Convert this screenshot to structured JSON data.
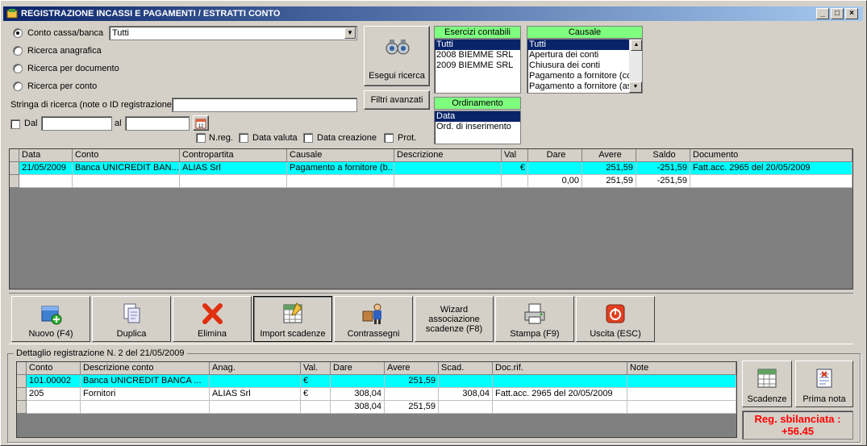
{
  "window": {
    "title": "REGISTRAZIONE INCASSI E PAGAMENTI / ESTRATTI CONTO"
  },
  "search": {
    "options": [
      {
        "label": "Conto cassa/banca",
        "selected": true
      },
      {
        "label": "Ricerca anagrafica",
        "selected": false
      },
      {
        "label": "Ricerca per documento",
        "selected": false
      },
      {
        "label": "Ricerca per conto",
        "selected": false
      }
    ],
    "account_value": "Tutti",
    "string_label": "Stringa di ricerca (note o ID registrazione)",
    "string_value": "",
    "dal_label": "Dal",
    "al_label": "al",
    "date_icon_text": "12",
    "flags": [
      "N.reg.",
      "Data valuta",
      "Data creazione",
      "Prot."
    ],
    "run_button": "Esegui ricerca",
    "advanced_button": "Filtri avanzati"
  },
  "esercizi": {
    "header": "Esercizi contabili",
    "items": [
      "Tutti",
      "2008 BIEMME SRL",
      "2009 BIEMME SRL"
    ]
  },
  "causale": {
    "header": "Causale",
    "items": [
      "Tutti",
      "Apertura dei conti",
      "Chiusura dei conti",
      "Pagamento a fornitore (co",
      "Pagamento a fornitore (as"
    ]
  },
  "ordinamento": {
    "header": "Ordinamento",
    "items": [
      "Data",
      "Ord. di inserimento"
    ]
  },
  "main_grid": {
    "columns": [
      "Data",
      "Conto",
      "Contropartita",
      "Causale",
      "Descrizione",
      "Val",
      "Dare",
      "Avere",
      "Saldo",
      "Documento"
    ],
    "rows": [
      [
        "21/05/2009",
        "Banca UNICREDIT BAN...",
        "ALIAS Srl",
        "Pagamento a fornitore (b...",
        "",
        "€",
        "",
        "251,59",
        "-251,59",
        "Fatt.acc. 2965 del 20/05/2009"
      ],
      [
        "",
        "",
        "",
        "",
        "",
        "",
        "0,00",
        "251,59",
        "-251,59",
        ""
      ]
    ]
  },
  "toolbar": {
    "nuovo": "Nuovo (F4)",
    "duplica": "Duplica",
    "elimina": "Elimina",
    "import": "Import scadenze",
    "contrassegni": "Contrassegni",
    "wizard": "Wizard associazione scadenze (F8)",
    "stampa": "Stampa (F9)",
    "uscita": "Uscita (ESC)"
  },
  "detail": {
    "legend": "Dettaglio registrazione N. 2 del 21/05/2009",
    "columns": [
      "Conto",
      "Descrizione conto",
      "Anag.",
      "Val.",
      "Dare",
      "Avere",
      "Scad.",
      "Doc.rif.",
      "Note"
    ],
    "rows": [
      [
        "101.00002",
        "Banca UNICREDIT BANCA ...",
        "",
        "€",
        "",
        "251,59",
        "",
        "",
        ""
      ],
      [
        "205",
        "Fornitori",
        "ALIAS Srl",
        "€",
        "308,04",
        "",
        "308,04",
        "Fatt.acc. 2965 del 20/05/2009",
        ""
      ],
      [
        "",
        "",
        "",
        "",
        "308,04",
        "251,59",
        "",
        "",
        ""
      ]
    ],
    "scadenze_button": "Scadenze",
    "prima_nota_button": "Prima nota",
    "status": "Reg. sbilanciata : +56.45"
  },
  "colors": {
    "title_start": "#0a246a",
    "title_end": "#a6caf0",
    "selected_row": "#00ffff",
    "list_header": "#7fff7f",
    "status_text": "#ff0000"
  }
}
